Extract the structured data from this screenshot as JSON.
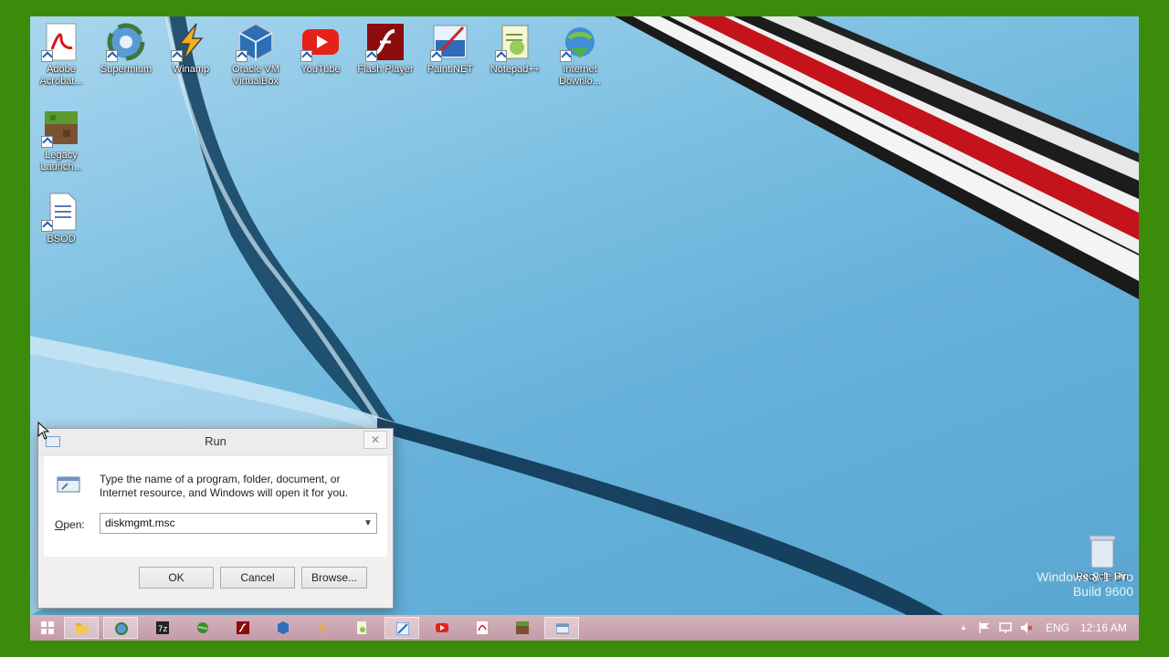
{
  "desktop_icons": [
    {
      "label": "Adobe Acrobat...",
      "icon": "acrobat-icon"
    },
    {
      "label": "Supermium",
      "icon": "browser-icon"
    },
    {
      "label": "Winamp",
      "icon": "winamp-icon"
    },
    {
      "label": "Oracle VM VirtualBox",
      "icon": "virtualbox-icon"
    },
    {
      "label": "YouTube",
      "icon": "youtube-icon"
    },
    {
      "label": "Flash Player",
      "icon": "flash-icon"
    },
    {
      "label": "Paint.NET",
      "icon": "paint-icon"
    },
    {
      "label": "Notepad++",
      "icon": "notepad-icon"
    },
    {
      "label": "Internet Downlo...",
      "icon": "download-manager-icon"
    },
    {
      "label": "Legacy Launch...",
      "icon": "minecraft-icon"
    },
    {
      "label": "BSOD",
      "icon": "document-icon"
    }
  ],
  "recycle_bin": {
    "label": "Recycle Bin"
  },
  "watermark": {
    "line1": "Windows 8.1 Pro",
    "line2": "Build 9600"
  },
  "run_dialog": {
    "title": "Run",
    "description": "Type the name of a program, folder, document, or Internet resource, and Windows will open it for you.",
    "open_label_underline": "O",
    "open_label_rest": "pen:",
    "input_value": "diskmgmt.msc",
    "ok_label": "OK",
    "cancel_label": "Cancel",
    "browse_label": "Browse...",
    "close_glyph": "✕"
  },
  "taskbar": {
    "items": [
      "start",
      "file-explorer",
      "browser",
      "7zip",
      "globe",
      "flash",
      "virtualbox",
      "winamp",
      "notepad",
      "paint",
      "youtube",
      "acrobat",
      "minecraft",
      "run"
    ],
    "tray": {
      "up_arrow": "▲",
      "language": "ENG",
      "time": "12:16 AM"
    }
  },
  "colors": {
    "accent": "#c8a4b0",
    "frame": "#3c8c0c",
    "youtube": "#e62117",
    "flash": "#8a0c0c"
  }
}
